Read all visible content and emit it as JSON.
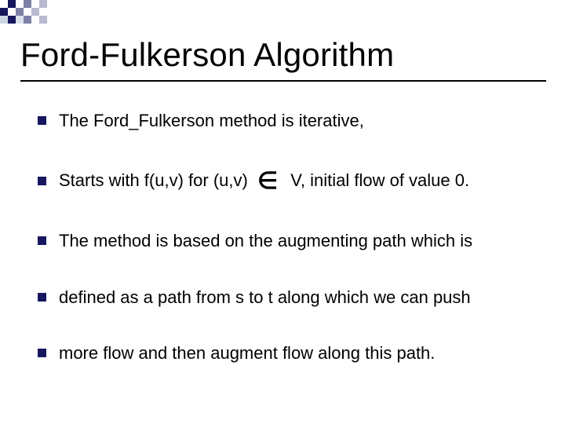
{
  "title": "Ford-Fulkerson Algorithm",
  "bullets": {
    "b0": "The Ford_Fulkerson method is iterative,",
    "b1_a": "Starts with f(u,v) for (u,v)",
    "b1_sym": "∈",
    "b1_b": " V, initial flow of value 0.",
    "b2": "The method is based on the augmenting path which is",
    "b3": "defined as a path from s to t along which we can push",
    "b4": "more flow and then augment flow along this path."
  }
}
